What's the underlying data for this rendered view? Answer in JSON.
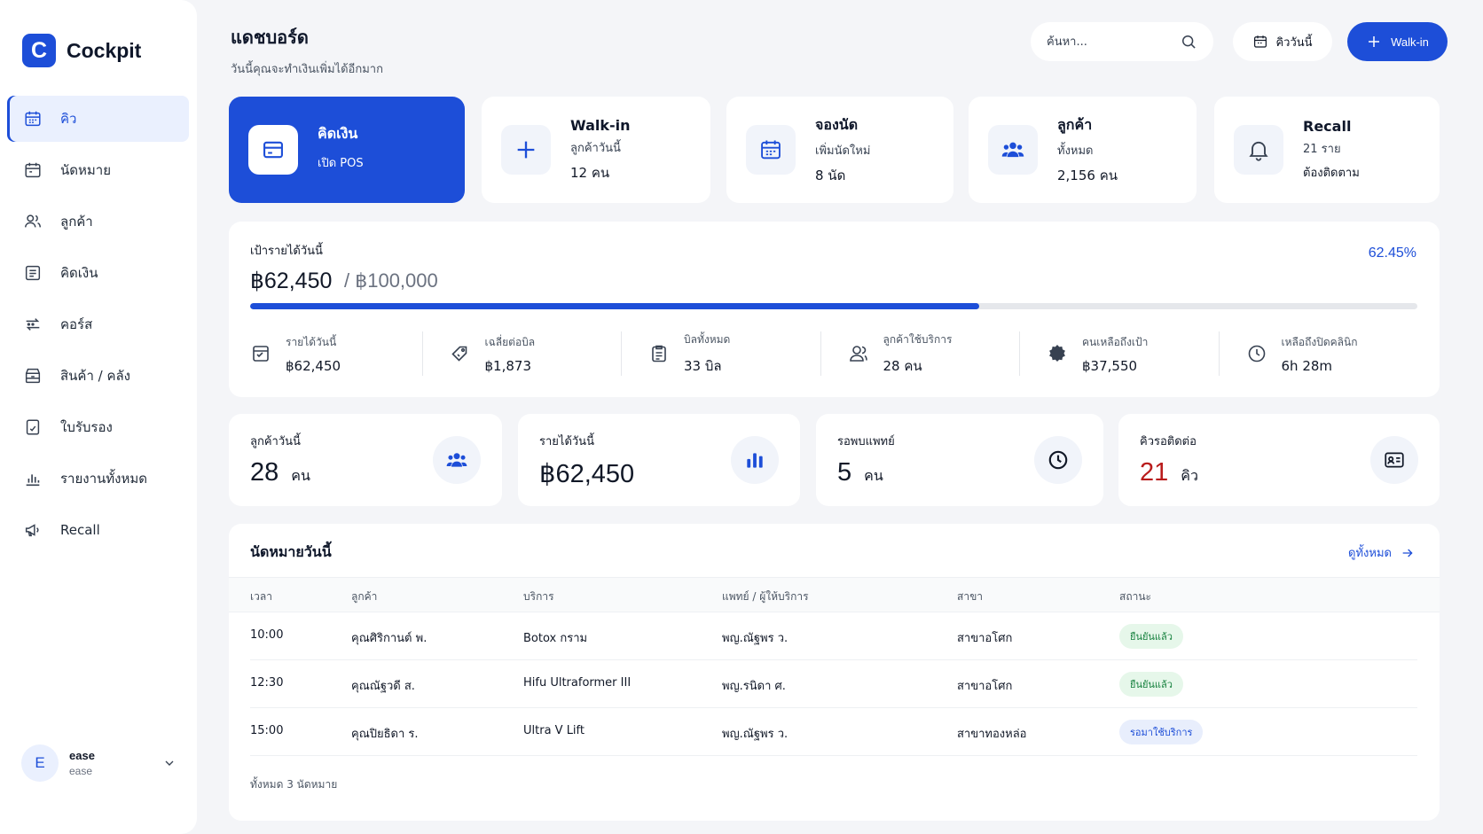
{
  "brand": {
    "logo_letter": "C",
    "name": "Cockpit"
  },
  "sidebar": {
    "items": [
      {
        "label": "คิว",
        "icon": "calendar-icon",
        "active": true
      },
      {
        "label": "นัดหมาย",
        "icon": "calendar-icon"
      },
      {
        "label": "ลูกค้า",
        "icon": "users-icon"
      },
      {
        "label": "คิดเงิน",
        "icon": "receipt-icon"
      },
      {
        "label": "คอร์ส",
        "icon": "exchange-icon"
      },
      {
        "label": "สินค้า / คลัง",
        "icon": "box-icon"
      },
      {
        "label": "ใบรับรอง",
        "icon": "certificate-icon"
      },
      {
        "label": "รายงานทั้งหมด",
        "icon": "bar-chart-icon"
      },
      {
        "label": "Recall",
        "icon": "megaphone-icon"
      }
    ],
    "user": {
      "initial": "E",
      "name": "ease",
      "role": "ease"
    }
  },
  "header": {
    "title": "แดชบอร์ด",
    "subtitle": "วันนี้คุณจะทำเงินเพิ่มได้อีกมาก",
    "search_placeholder": "ค้นหา...",
    "date_label": "คิววันนี้",
    "walkin_label": "Walk-in"
  },
  "actions": [
    {
      "title": "คิดเงิน",
      "sub": "เปิด POS"
    },
    {
      "title": "Walk-in",
      "sub": "ลูกค้าวันนี้",
      "value": "12 คน"
    },
    {
      "title": "จองนัด",
      "sub": "เพิ่มนัดใหม่",
      "value": "8 นัด"
    },
    {
      "title": "ลูกค้า",
      "sub": "ทั้งหมด",
      "value": "2,156 คน"
    },
    {
      "title": "Recall",
      "sub": "21 ราย",
      "value": "ต้องติดตาม"
    }
  ],
  "target": {
    "label": "เป้ารายได้วันนี้",
    "current": "฿62,450",
    "goal": "/ ฿100,000",
    "percent_text": "62.45%",
    "progress": 0.6245,
    "stats": [
      {
        "label": "รายได้วันนี้",
        "value": "฿62,450",
        "icon": "receipt-icon"
      },
      {
        "label": "เฉลี่ยต่อบิล",
        "value": "฿1,873",
        "icon": "tag-icon"
      },
      {
        "label": "บิลทั้งหมด",
        "value": "33 บิล",
        "icon": "clipboard-icon"
      },
      {
        "label": "ลูกค้าใช้บริการ",
        "value": "28 คน",
        "icon": "user-icon"
      },
      {
        "label": "คนเหลือถึงเป้า",
        "value": "฿37,550",
        "icon": "badge-icon"
      },
      {
        "label": "เหลือถึงปิดคลินิก",
        "value": "6h 28m",
        "icon": "clock-icon"
      }
    ]
  },
  "metrics": [
    {
      "label": "ลูกค้าวันนี้",
      "value": "28",
      "unit": "คน",
      "icon": "users-icon"
    },
    {
      "label": "รายได้วันนี้",
      "value": "฿62,450",
      "unit": "",
      "icon": "bar-chart-icon"
    },
    {
      "label": "รอพบแพทย์",
      "value": "5",
      "unit": "คน",
      "icon": "clock-icon"
    },
    {
      "label": "คิวรอติดต่อ",
      "value": "21",
      "unit": "คิว",
      "icon": "id-card-icon"
    }
  ],
  "appointments": {
    "title": "นัดหมายวันนี้",
    "view_all": "ดูทั้งหมด",
    "columns": [
      "เวลา",
      "ลูกค้า",
      "บริการ",
      "แพทย์ / ผู้ให้บริการ",
      "สาขา",
      "สถานะ"
    ],
    "rows": [
      {
        "time": "10:00",
        "customer": "คุณศิริกานต์ พ.",
        "service": "Botox กราม",
        "doctor": "พญ.ณัฐพร ว.",
        "branch": "สาขาอโศก",
        "status": "ยืนยันแล้ว"
      },
      {
        "time": "12:30",
        "customer": "คุณณัฐวดี ส.",
        "service": "Hifu Ultraformer III",
        "doctor": "พญ.รนิดา ศ.",
        "branch": "สาขาอโศก",
        "status": "ยืนยันแล้ว"
      },
      {
        "time": "15:00",
        "customer": "คุณปิยธิดา ร.",
        "service": "Ultra V Lift",
        "doctor": "พญ.ณัฐพร ว.",
        "branch": "สาขาทองหล่อ",
        "status": "รอมาใช้บริการ"
      }
    ],
    "total": "ทั้งหมด 3 นัดหมาย"
  },
  "colors": {
    "primary": "#1d4ed8",
    "success": "#15803d",
    "danger": "#b91c1c"
  }
}
